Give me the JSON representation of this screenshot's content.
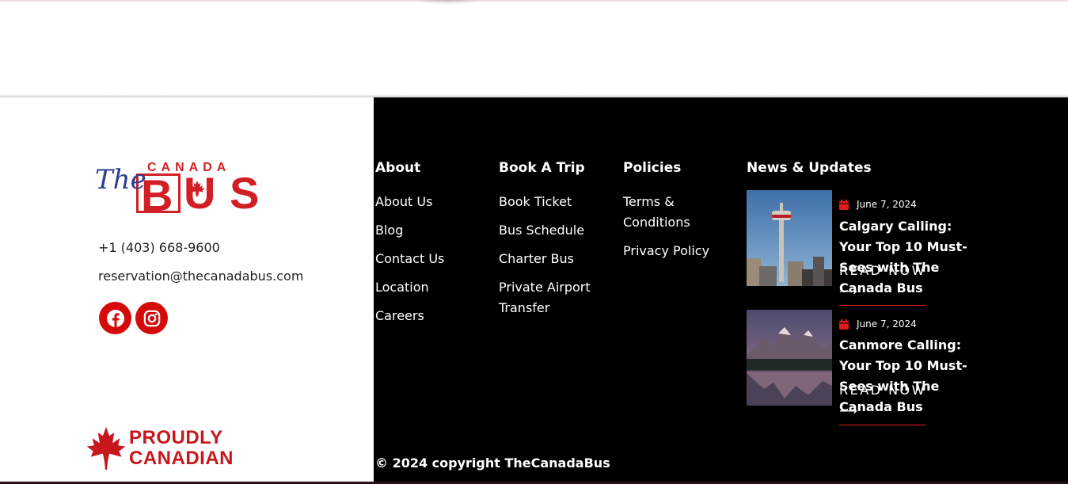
{
  "brand": {
    "logo_the": "The",
    "logo_canada": "CANADA",
    "logo_bus": "BUS",
    "logo_alt": "The Canada Bus logo",
    "primary_color": "#d21f26",
    "secondary_color": "#2c3f8f"
  },
  "contact": {
    "phone": "+1 (403) 668-9600",
    "email": "reservation@thecanadabus.com"
  },
  "social": [
    {
      "name": "facebook-icon",
      "color": "#d50b0b"
    },
    {
      "name": "instagram-icon",
      "color": "#d50b0b"
    }
  ],
  "badge": {
    "line1": "PROUDLY",
    "line2": "CANADIAN"
  },
  "columns": {
    "about": {
      "title": "About",
      "links": [
        "About Us",
        "Blog",
        "Contact Us",
        "Location",
        "Careers"
      ]
    },
    "book": {
      "title": "Book A Trip",
      "links": [
        "Book Ticket",
        "Bus Schedule",
        "Charter Bus",
        "Private Airport Transfer"
      ]
    },
    "policies": {
      "title": "Policies",
      "links": [
        "Terms & Conditions",
        "Privacy Policy"
      ]
    },
    "news": {
      "title": "News & Updates",
      "items": [
        {
          "date": "June 7, 2024",
          "title": "Calgary Calling: Your Top 10 Must-Sees with The Canada Bus",
          "cta": "READ NOW"
        },
        {
          "date": "June 7, 2024",
          "title": "Canmore Calling: Your Top 10 Must-Sees with The Canada Bus",
          "cta": "READ NOW"
        }
      ]
    }
  },
  "copyright": "© 2024 copyright TheCanadaBus"
}
